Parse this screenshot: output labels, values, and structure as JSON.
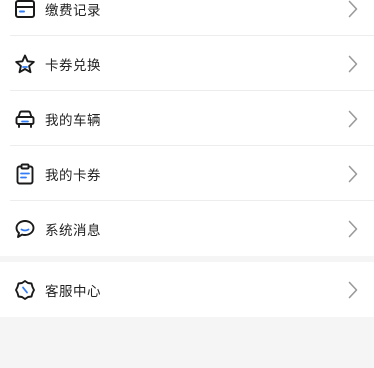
{
  "colors": {
    "page_background": "#f5f5f5",
    "card_background": "#ffffff",
    "text": "#222222",
    "icon": "#1a1a1a",
    "icon_accent": "#2f7cf6",
    "chevron": "#9a9a9a",
    "divider": "#ededed"
  },
  "menu": {
    "group1": [
      {
        "label": "缴费记录",
        "icon": "wallet-icon"
      },
      {
        "label": "卡券兑换",
        "icon": "star-icon"
      },
      {
        "label": "我的车辆",
        "icon": "car-icon"
      },
      {
        "label": "我的卡券",
        "icon": "clipboard-icon"
      },
      {
        "label": "系统消息",
        "icon": "chat-bubble-icon"
      }
    ],
    "group2": [
      {
        "label": "客服中心",
        "icon": "support-badge-icon"
      }
    ]
  }
}
